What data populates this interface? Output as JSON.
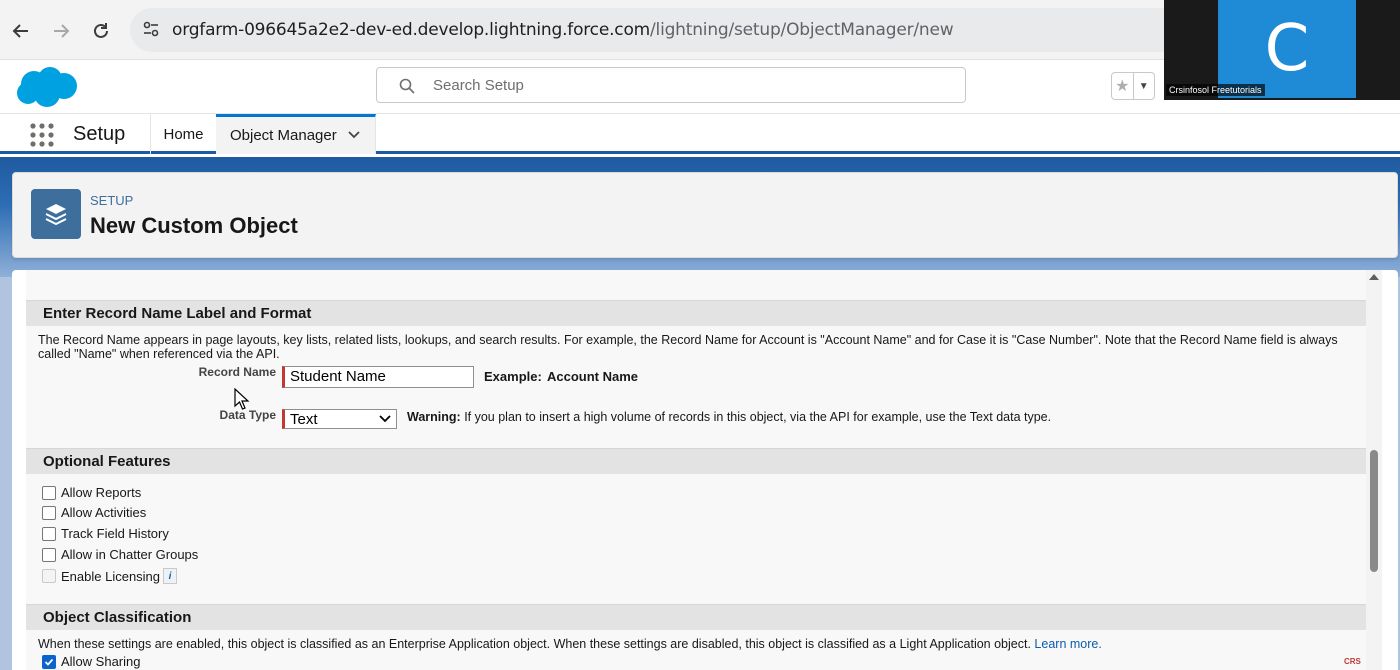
{
  "browser": {
    "url_host": "orgfarm-096645a2e2-dev-ed.develop.lightning.force.com",
    "url_path": "/lightning/setup/ObjectManager/new"
  },
  "header": {
    "search_placeholder": "Search Setup"
  },
  "nav": {
    "app_name": "Setup",
    "tabs": [
      {
        "label": "Home"
      },
      {
        "label": "Object Manager"
      }
    ]
  },
  "page_header": {
    "eyebrow": "SETUP",
    "title": "New Custom Object"
  },
  "record_name_section": {
    "heading": "Enter Record Name Label and Format",
    "description": "The Record Name appears in page layouts, key lists, related lists, lookups, and search results. For example, the Record Name for Account is \"Account Name\" and for Case it is \"Case Number\". Note that the Record Name field is always called \"Name\" when referenced via the API.",
    "record_name_label": "Record Name",
    "record_name_value": "Student Name",
    "example_label": "Example:",
    "example_value": "Account Name",
    "data_type_label": "Data Type",
    "data_type_value": "Text",
    "warning_label": "Warning:",
    "warning_text": "If you plan to insert a high volume of records in this object, via the API for example, use the Text data type."
  },
  "optional_features": {
    "heading": "Optional Features",
    "items": [
      {
        "label": "Allow Reports",
        "checked": false,
        "disabled": false
      },
      {
        "label": "Allow Activities",
        "checked": false,
        "disabled": false
      },
      {
        "label": "Track Field History",
        "checked": false,
        "disabled": false
      },
      {
        "label": "Allow in Chatter Groups",
        "checked": false,
        "disabled": false
      },
      {
        "label": "Enable Licensing",
        "checked": false,
        "disabled": true
      }
    ],
    "info_icon": "i"
  },
  "object_classification": {
    "heading": "Object Classification",
    "description": "When these settings are enabled, this object is classified as an Enterprise Application object. When these settings are disabled, this object is classified as a Light Application object.",
    "learn_more": "Learn more.",
    "allow_sharing_label": "Allow Sharing",
    "allow_sharing_checked": true
  },
  "webcam": {
    "initial": "C",
    "caption": "Crsinfosol Freetutorials"
  },
  "watermark": "CRS",
  "colors": {
    "brand_blue": "#1b5aa5",
    "required_red": "#c23934",
    "icon_tile": "#3e6f9c",
    "webcam_tile": "#1f8ad6"
  }
}
